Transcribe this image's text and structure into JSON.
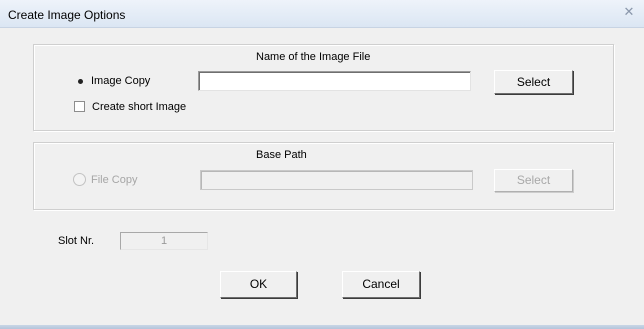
{
  "window": {
    "title": "Create Image Options"
  },
  "image_group": {
    "header": "Name of the Image File",
    "image_copy_label": "Image Copy",
    "image_copy_selected": true,
    "short_image_label": "Create short Image",
    "short_image_checked": false,
    "file_name_value": "",
    "select_label": "Select"
  },
  "file_group": {
    "header": "Base Path",
    "file_copy_label": "File Copy",
    "file_copy_selected": false,
    "base_path_value": "",
    "select_label": "Select",
    "enabled": false
  },
  "slot": {
    "label": "Slot Nr.",
    "value": "1"
  },
  "buttons": {
    "ok_label": "OK",
    "cancel_label": "Cancel"
  }
}
